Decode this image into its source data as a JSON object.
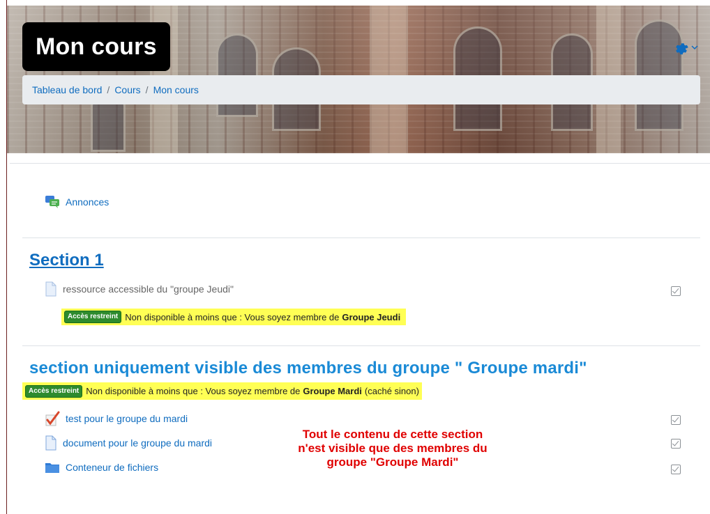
{
  "header": {
    "course_title": "Mon cours",
    "breadcrumb": [
      "Tableau de bord",
      "Cours",
      "Mon cours"
    ],
    "breadcrumb_separator": "/"
  },
  "general_section": {
    "activities": [
      {
        "label": "Annonces",
        "icon": "forum-icon"
      }
    ]
  },
  "section1": {
    "title": "Section 1",
    "activities": [
      {
        "label": "ressource accessible du \"groupe Jeudi\"",
        "icon": "file-icon",
        "greyed": true
      }
    ],
    "restriction": {
      "badge": "Accès restreint",
      "text": "Non disponible à moins que : Vous soyez membre de",
      "group": "Groupe Jeudi"
    }
  },
  "section2": {
    "title": "section uniquement visible des membres du groupe \" Groupe mardi\"",
    "restriction": {
      "badge": "Accès restreint",
      "text": "Non disponible à moins que : Vous soyez membre de",
      "group": "Groupe Mardi",
      "suffix": "(caché sinon)"
    },
    "activities": [
      {
        "label": "test pour le groupe du mardi",
        "icon": "quiz-icon"
      },
      {
        "label": "document pour le groupe du mardi",
        "icon": "file-icon"
      },
      {
        "label": "Conteneur de fichiers",
        "icon": "folder-icon"
      }
    ]
  },
  "annotation": {
    "lines": [
      "Tout le contenu de cette section",
      "n'est visible que des membres du",
      "groupe \"Groupe Mardi\""
    ]
  },
  "colors": {
    "link": "#0f6cbf",
    "highlight": "#ffff55",
    "badge": "#2e8b2e",
    "annotation": "#e00000"
  }
}
